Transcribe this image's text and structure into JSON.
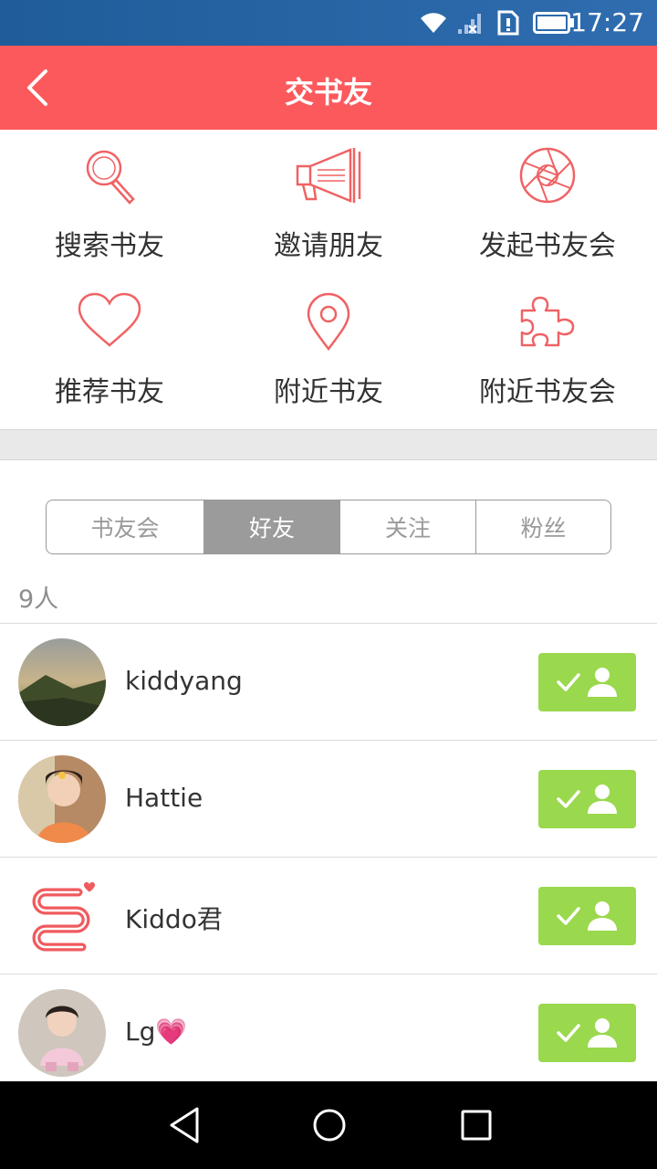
{
  "status_bar": {
    "time": "17:27",
    "icons": [
      "wifi-icon",
      "signal-icon",
      "sim-alert-icon",
      "battery-icon"
    ]
  },
  "header": {
    "title": "交书友",
    "back_icon": "chevron-left-icon"
  },
  "actions": [
    {
      "label": "搜索书友",
      "icon": "search-icon"
    },
    {
      "label": "邀请朋友",
      "icon": "megaphone-icon"
    },
    {
      "label": "发起书友会",
      "icon": "aperture-icon"
    },
    {
      "label": "推荐书友",
      "icon": "heart-icon"
    },
    {
      "label": "附近书友",
      "icon": "location-pin-icon"
    },
    {
      "label": "附近书友会",
      "icon": "puzzle-icon"
    }
  ],
  "tabs": [
    {
      "label": "书友会",
      "active": false
    },
    {
      "label": "好友",
      "active": true
    },
    {
      "label": "关注",
      "active": false
    },
    {
      "label": "粉丝",
      "active": false
    }
  ],
  "count_label": "9人",
  "friends": [
    {
      "name": "kiddyang"
    },
    {
      "name": "Hattie"
    },
    {
      "name": "Kiddo君"
    },
    {
      "name": "Lg💗"
    }
  ],
  "colors": {
    "brand": "#fb595c",
    "follow_button": "#9ad84d",
    "tab_active": "#9b9b9b"
  }
}
